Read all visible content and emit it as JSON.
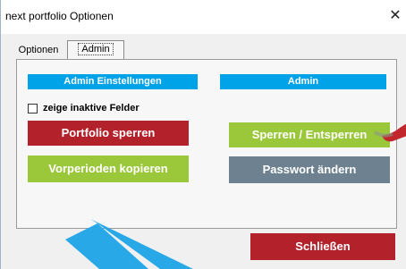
{
  "window": {
    "title": "next portfolio Optionen",
    "close_glyph": "✕"
  },
  "tabs": [
    {
      "label": "Optionen",
      "active": false
    },
    {
      "label": "Admin",
      "active": true
    }
  ],
  "admin_panel": {
    "header_left": "Admin Einstellungen",
    "header_right": "Admin",
    "checkbox": {
      "label": "zeige inaktive Felder",
      "checked": false
    },
    "buttons": {
      "portfolio_sperren": "Portfolio sperren",
      "sperren_entsperren": "Sperren / Entsperren",
      "vorperioden_kopieren": "Vorperioden kopieren",
      "passwort_aendern": "Passwort ändern"
    }
  },
  "footer": {
    "close_button": "Schließen"
  },
  "colors": {
    "header_blue": "#00a2e8",
    "button_red": "#b3222a",
    "button_green": "#9bc73b",
    "button_gray": "#6e8190",
    "annotation_blue": "#29a8e8",
    "annotation_red": "#c1272d"
  }
}
